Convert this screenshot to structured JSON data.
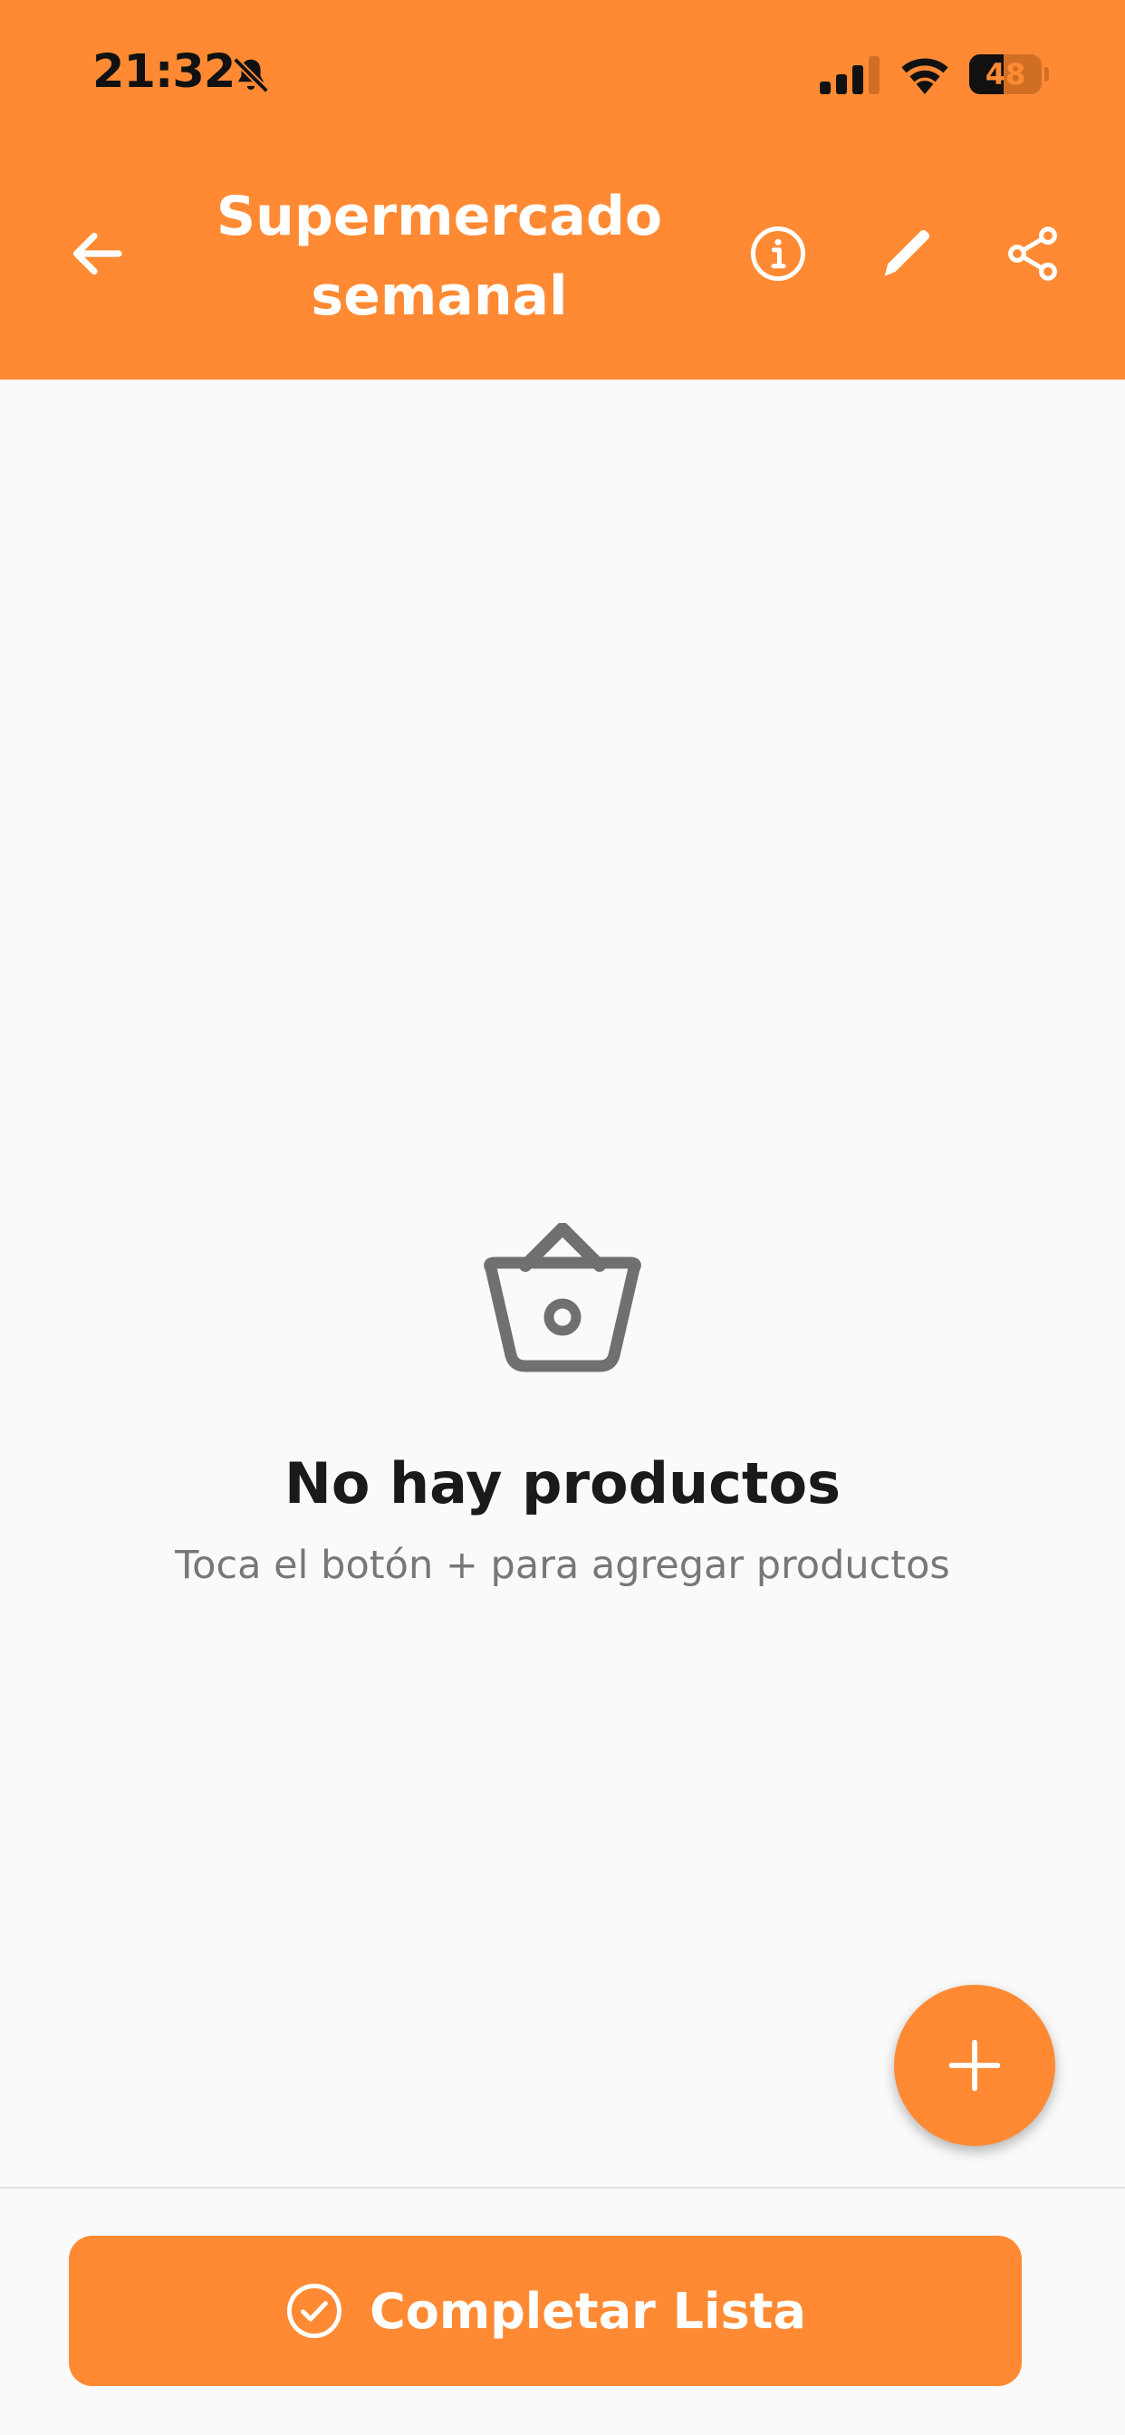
{
  "status_bar": {
    "time": "21:32",
    "battery_level": "48",
    "battery_fraction": 0.48,
    "icons": [
      "bell-slash-icon",
      "cellular-signal-icon",
      "wifi-icon",
      "battery-icon"
    ]
  },
  "header": {
    "title": "Supermercado semanal",
    "background_color": "#ff8a33",
    "icons": [
      "arrow-left-icon",
      "info-circle-icon",
      "pencil-icon",
      "share-icon"
    ]
  },
  "empty_state": {
    "icon": "shopping-basket-icon",
    "title": "No hay productos",
    "subtitle": "Toca el botón + para agregar productos"
  },
  "fab": {
    "icon": "plus-icon"
  },
  "bottom_bar": {
    "complete_button_label": "Completar Lista",
    "complete_button_icon": "check-circle-icon"
  },
  "colors": {
    "accent": "#ff8a33",
    "background": "#fafafa",
    "title_text": "#1a1a1a",
    "subtitle_text": "#777777"
  }
}
